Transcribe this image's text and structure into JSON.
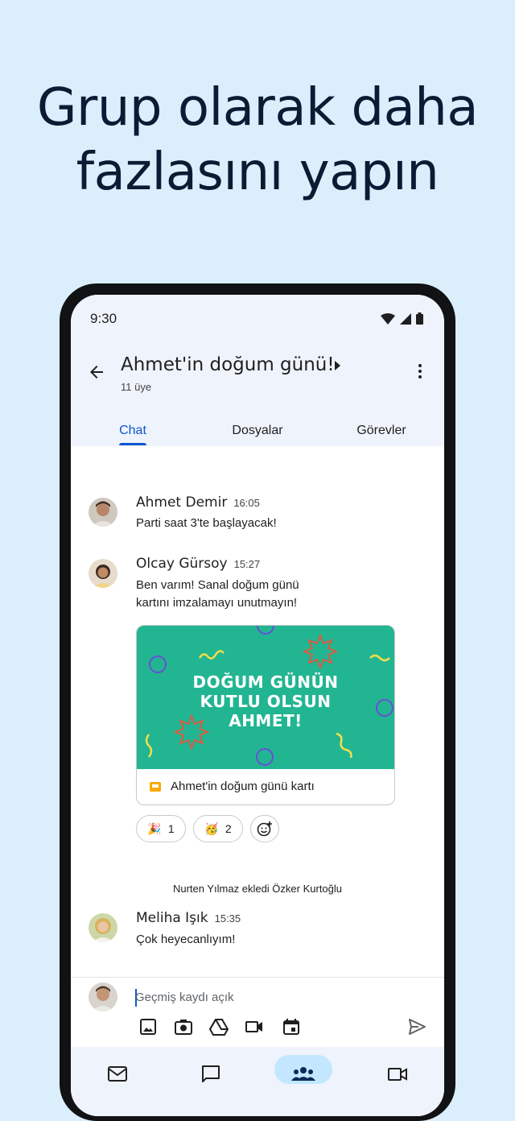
{
  "headline": {
    "line1": "Grup olarak daha",
    "line2": "fazlasını yapın"
  },
  "status_bar": {
    "time": "9:30",
    "icons": [
      "wifi-icon",
      "signal-icon",
      "battery-icon"
    ]
  },
  "header": {
    "title": "Ahmet'in doğum günü!",
    "subtitle": "11 üye"
  },
  "tabs": [
    {
      "label": "Chat",
      "active": true
    },
    {
      "label": "Dosyalar"
    },
    {
      "label": "Görevler"
    }
  ],
  "messages": [
    {
      "name": "Ahmet Demir",
      "time": "16:05",
      "lines": [
        "Parti saat 3'te başlayacak!"
      ]
    },
    {
      "name": "Olcay Gürsoy",
      "time": "15:27",
      "lines": [
        "Ben varım! Sanal doğum günü",
        "kartını imzalamayı unutmayın!"
      ]
    },
    {
      "name": "Meliha Işık",
      "time": "15:35",
      "lines": [
        "Çok heyecanlıyım!"
      ]
    }
  ],
  "card": {
    "heading_lines": [
      "DOĞUM GÜNÜN",
      "KUTLU OLSUN",
      "AHMET!"
    ],
    "footer": "Ahmet'in doğum günü kartı",
    "bg_color": "#22b592"
  },
  "reactions": [
    {
      "emoji": "🎉",
      "count": "1"
    },
    {
      "emoji": "🥳",
      "count": "2"
    }
  ],
  "system_message": "Nurten Yılmaz ekledi Özker Kurtoğlu",
  "composer": {
    "placeholder": "Geçmiş kaydı açık"
  },
  "composer_tools": [
    "image-icon",
    "camera-icon",
    "drive-icon",
    "video-icon",
    "calendar-icon",
    "send-icon"
  ],
  "bottom_nav": [
    "mail-icon",
    "chat-icon",
    "spaces-icon",
    "meet-icon"
  ],
  "colors": {
    "accent": "#0b57d0",
    "background": "#dbeefc",
    "nav_active": "#c2e7ff"
  }
}
